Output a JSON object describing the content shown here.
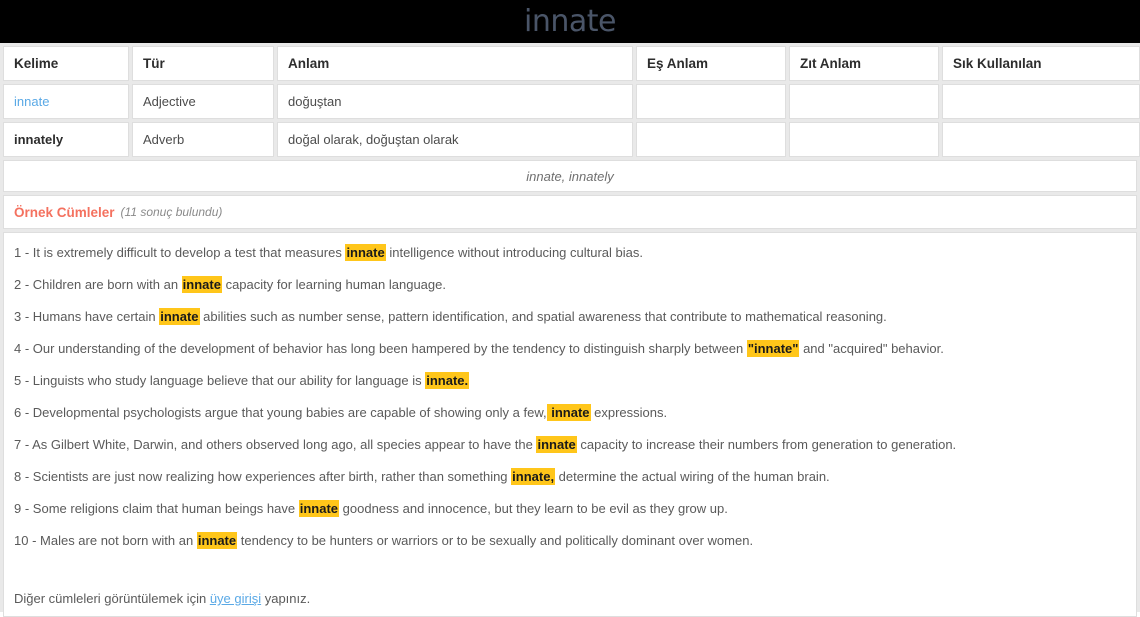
{
  "header": {
    "title": "innate"
  },
  "word_table": {
    "columns": [
      "Kelime",
      "Tür",
      "Anlam",
      "Eş Anlam",
      "Zıt Anlam",
      "Sık Kullanılan"
    ],
    "rows": [
      {
        "kelime": "innate",
        "tur": "Adjective",
        "anlam": "doğuştan",
        "es_anlam": "",
        "zit_anlam": "",
        "sik_kullanilan": ""
      },
      {
        "kelime": "innately",
        "tur": "Adverb",
        "anlam": "doğal olarak, doğuştan olarak",
        "es_anlam": "",
        "zit_anlam": "",
        "sik_kullanilan": ""
      }
    ]
  },
  "related": {
    "text": "innate, innately"
  },
  "examples": {
    "title": "Örnek Cümleler",
    "count_label": "(11 sonuç bulundu)",
    "items": [
      {
        "number": "1 - ",
        "pre": "It is extremely difficult to develop a test that measures ",
        "highlight": "innate",
        "post": " intelligence without introducing cultural bias."
      },
      {
        "number": "2 - ",
        "pre": "Children are born with an ",
        "highlight": "innate",
        "post": " capacity for learning human language."
      },
      {
        "number": "3 - ",
        "pre": "Humans have certain ",
        "highlight": "innate",
        "post": " abilities such as number sense, pattern identification, and spatial awareness that contribute to mathematical reasoning."
      },
      {
        "number": "4 - ",
        "pre": "Our understanding of the development of behavior has long been hampered by the tendency to distinguish sharply between ",
        "highlight": "\"innate\"",
        "post": " and \"acquired\" behavior."
      },
      {
        "number": "5 - ",
        "pre": "Linguists who study language believe that our ability for language is ",
        "highlight": "innate.",
        "post": ""
      },
      {
        "number": "6 - ",
        "pre": "Developmental psychologists argue that young babies are capable of showing only a few,",
        "highlight": " innate",
        "post": " expressions."
      },
      {
        "number": "7 - ",
        "pre": "As Gilbert White, Darwin, and others observed long ago, all species appear to have the ",
        "highlight": "innate",
        "post": " capacity to increase their numbers from generation to generation."
      },
      {
        "number": "8 - ",
        "pre": "Scientists are just now realizing how experiences after birth, rather than something ",
        "highlight": "innate,",
        "post": " determine the actual wiring of the human brain."
      },
      {
        "number": "9 - ",
        "pre": "Some religions claim that human beings have ",
        "highlight": "innate",
        "post": " goodness and innocence, but they learn to be evil as they grow up."
      },
      {
        "number": "10 - ",
        "pre": "Males are not born with an ",
        "highlight": "innate",
        "post": " tendency to be hunters or warriors or to be sexually and politically dominant over women."
      }
    ],
    "footer": {
      "pre": "Diğer cümleleri görüntülemek için ",
      "link": "üye girişi",
      "post": " yapınız."
    }
  },
  "colors": {
    "topbar_bg": "#000000",
    "topbar_title": "#4a5568",
    "link": "#5aa9e6",
    "highlight_bg": "#ffc61a",
    "examples_title": "#f4715f",
    "page_bg": "#e9e9e9"
  }
}
